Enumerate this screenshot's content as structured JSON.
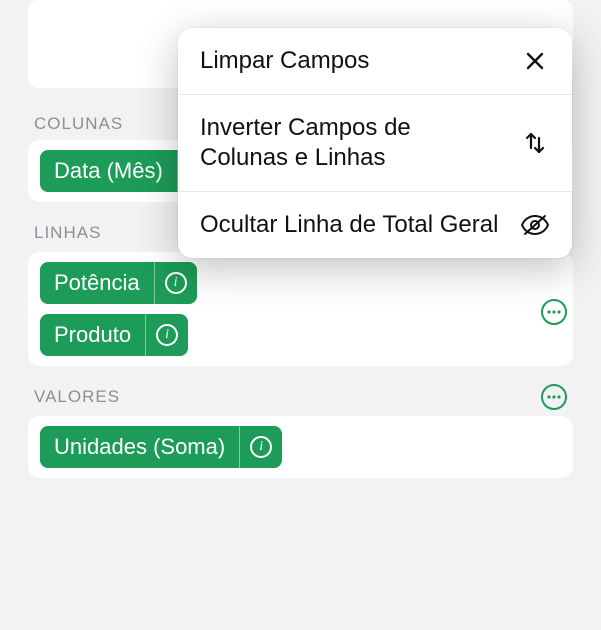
{
  "popover": {
    "items": [
      {
        "label": "Limpar Campos",
        "icon": "close-icon"
      },
      {
        "label": "Inverter Campos de Colunas e Linhas",
        "icon": "swap-icon"
      },
      {
        "label": "Ocultar Linha de Total Geral",
        "icon": "eye-off-icon"
      }
    ]
  },
  "sections": {
    "columns": {
      "title": "COLUNAS",
      "pills": [
        {
          "label": "Data (Mês)"
        }
      ]
    },
    "rows": {
      "title": "LINHAS",
      "pills": [
        {
          "label": "Potência"
        },
        {
          "label": "Produto"
        }
      ]
    },
    "values": {
      "title": "VALORES",
      "pills": [
        {
          "label": "Unidades (Soma)"
        }
      ]
    }
  },
  "colors": {
    "accent": "#1c9c58"
  }
}
